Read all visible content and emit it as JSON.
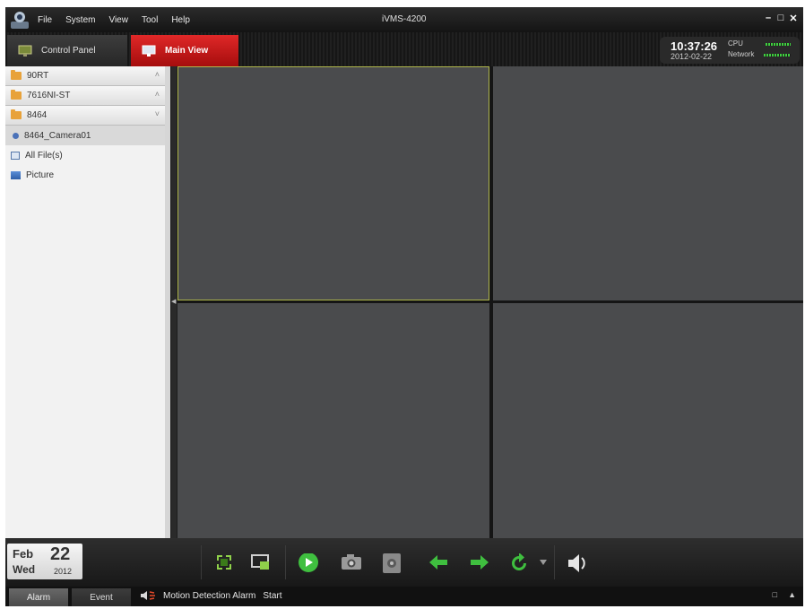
{
  "titlebar": {
    "menu": [
      "File",
      "System",
      "View",
      "Tool",
      "Help"
    ],
    "title": "iVMS-4200",
    "minimize": "–",
    "maximize": "□",
    "close": "✕"
  },
  "tabs": {
    "control_panel": "Control Panel",
    "main_view": "Main View"
  },
  "clock": {
    "time": "10:37:26",
    "date": "2012-02-22",
    "cpu_label": "CPU",
    "network_label": "Network"
  },
  "sidebar": {
    "groups": [
      {
        "label": "90RT",
        "chevron": "˄"
      },
      {
        "label": "7616NI-ST",
        "chevron": "˄"
      },
      {
        "label": "8464",
        "chevron": "˅"
      }
    ],
    "camera": "8464_Camera01",
    "all_files": "All File(s)",
    "picture": "Picture"
  },
  "datebox": {
    "month": "Feb",
    "day": "22",
    "weekday": "Wed",
    "year": "2012"
  },
  "statusbar": {
    "alarm_tab": "Alarm",
    "event_tab": "Event",
    "message": "Motion Detection Alarm",
    "message_status": "Start"
  },
  "colors": {
    "accent_red": "#c91414",
    "pane_gray": "#4a4b4d",
    "selected_pane_border": "#b0b84c",
    "toolbar_green": "#3fbf3f"
  },
  "icons": [
    "app-logo-icon",
    "monitor-icon",
    "folder-icon",
    "camera-icon",
    "file-icon",
    "picture-icon",
    "fullscreen-icon",
    "layout-icon",
    "play-icon",
    "snapshot-icon",
    "record-icon",
    "prev-arrow-icon",
    "next-arrow-icon",
    "refresh-icon",
    "dropdown-icon",
    "volume-icon",
    "alarm-speaker-icon"
  ]
}
